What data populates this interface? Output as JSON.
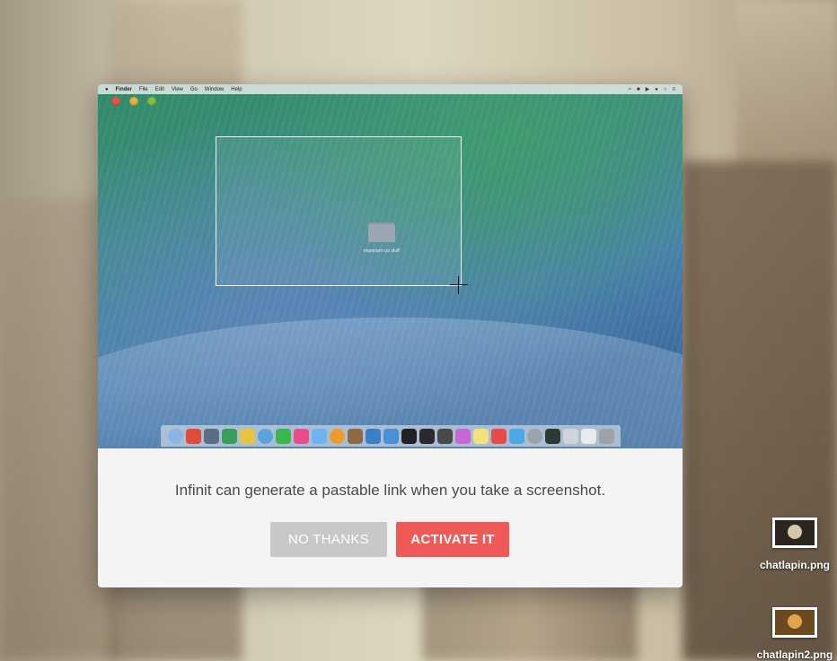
{
  "dialog": {
    "screenshot_preview": {
      "menubar": {
        "apple_icon": "apple-icon",
        "items": [
          "Finder",
          "File",
          "Edit",
          "View",
          "Go",
          "Window",
          "Help"
        ],
        "status_icons": [
          "wifi-icon",
          "lock-icon",
          "volume-icon",
          "user-icon",
          "spotlight-icon",
          "notification-list-icon"
        ]
      },
      "folder": {
        "label": "important cat stuff",
        "icon": "folder-icon"
      },
      "dock_colors": [
        "#8ab4e6",
        "#e04b3c",
        "#5a6f86",
        "#3a9d5b",
        "#e7c440",
        "#5ba3e0",
        "#3cb54a",
        "#e84c8b",
        "#6db3f2",
        "#f09a2c",
        "#8c6a45",
        "#3b7fc4",
        "#4a90d9",
        "#222222",
        "#2b2b2b",
        "#4a4a4a",
        "#c966d6",
        "#f2e27a",
        "#e84a4a",
        "#4ea7e6",
        "#9aa4ad",
        "#2d3a32",
        "#d0d4d8",
        "#e8eaec",
        "#9ea3a7"
      ]
    },
    "message": "Infinit can generate a pastable link when you take a screenshot.",
    "buttons": {
      "no_thanks": "NO THANKS",
      "activate": "ACTIVATE IT"
    }
  },
  "desktop_files": [
    {
      "name": "chatlapin.png"
    },
    {
      "name": "chatlapin2.png"
    }
  ],
  "colors": {
    "activate_button": "#ef5a58",
    "no_thanks_button": "#c8c8c8",
    "dialog_background": "#f4f4f4"
  }
}
